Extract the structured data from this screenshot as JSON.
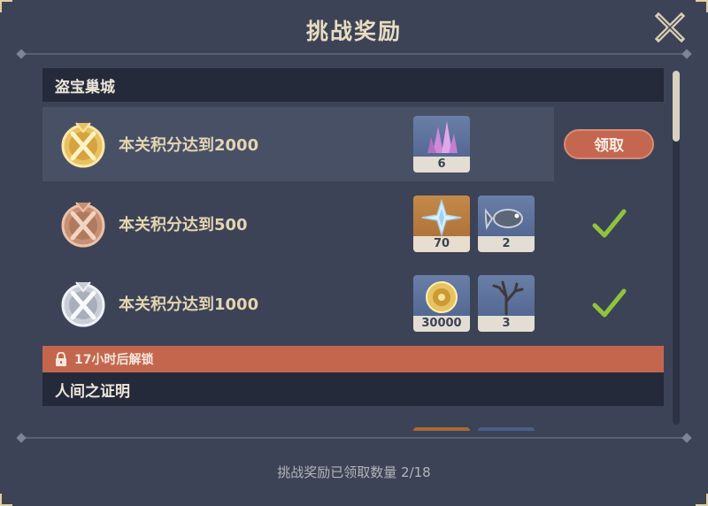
{
  "window": {
    "title": "挑战奖励"
  },
  "sections": [
    {
      "name": "盗宝巢城",
      "rows": [
        {
          "medal": "gold-medal",
          "label": "本关积分达到2000",
          "rewards": [
            {
              "icon": "crystal-ore-icon",
              "qty": "6"
            }
          ],
          "status": "claim",
          "claim_label": "领取"
        },
        {
          "medal": "bronze-medal",
          "label": "本关积分达到500",
          "rewards": [
            {
              "icon": "primogem-icon",
              "qty": "70"
            },
            {
              "icon": "fish-icon",
              "qty": "2"
            }
          ],
          "status": "claimed"
        },
        {
          "medal": "silver-medal",
          "label": "本关积分达到1000",
          "rewards": [
            {
              "icon": "mora-icon",
              "qty": "30000"
            },
            {
              "icon": "coral-branch-icon",
              "qty": "3"
            }
          ],
          "status": "claimed"
        }
      ]
    }
  ],
  "lock": {
    "label": "17小时后解锁"
  },
  "next_section": {
    "name": "人间之证明"
  },
  "footer": {
    "text": "挑战奖励已领取数量 2/18"
  },
  "colors": {
    "accent": "#c46650",
    "check": "#8ec43d",
    "gold": "#e7c260",
    "panel": "#3c4356"
  }
}
